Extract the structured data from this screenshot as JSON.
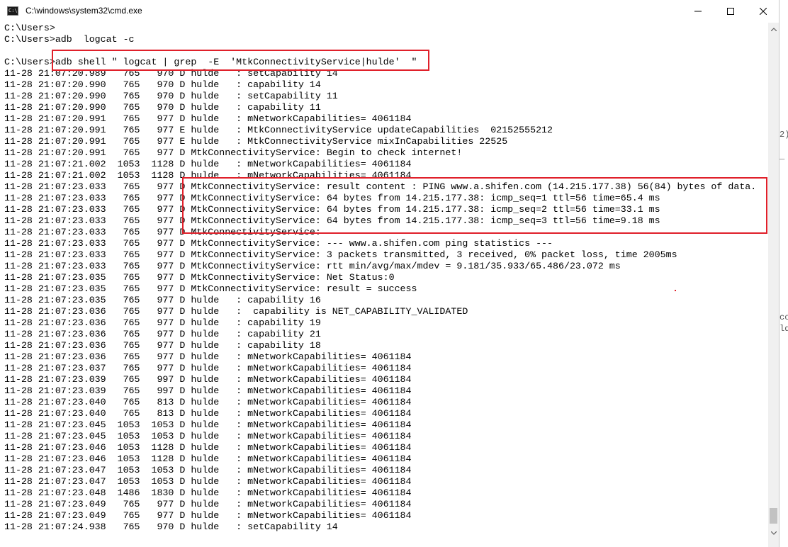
{
  "window": {
    "title": "C:\\windows\\system32\\cmd.exe",
    "icon": "cmd-app-icon",
    "controls": [
      "minimize-icon",
      "maximize-icon",
      "close-icon"
    ]
  },
  "terminal": {
    "lines": [
      "C:\\Users>",
      "C:\\Users>adb  logcat -c",
      "",
      "C:\\Users>adb shell \" logcat | grep  -E  'MtkConnectivityService|hulde'  \"",
      "11-28 21:07:20.989   765   970 D hulde   : setCapability 14",
      "11-28 21:07:20.990   765   970 D hulde   : capability 14",
      "11-28 21:07:20.990   765   970 D hulde   : setCapability 11",
      "11-28 21:07:20.990   765   970 D hulde   : capability 11",
      "11-28 21:07:20.991   765   977 D hulde   : mNetworkCapabilities= 4061184",
      "11-28 21:07:20.991   765   977 E hulde   : MtkConnectivityService updateCapabilities  02152555212",
      "11-28 21:07:20.991   765   977 E hulde   : MtkConnectivityService mixInCapabilities 22525",
      "11-28 21:07:20.991   765   977 D MtkConnectivityService: Begin to check internet!",
      "11-28 21:07:21.002  1053  1128 D hulde   : mNetworkCapabilities= 4061184",
      "11-28 21:07:21.002  1053  1128 D hulde   : mNetworkCapabilities= 4061184",
      "11-28 21:07:23.033   765   977 D MtkConnectivityService: result content : PING www.a.shifen.com (14.215.177.38) 56(84) bytes of data.",
      "11-28 21:07:23.033   765   977 D MtkConnectivityService: 64 bytes from 14.215.177.38: icmp_seq=1 ttl=56 time=65.4 ms",
      "11-28 21:07:23.033   765   977 D MtkConnectivityService: 64 bytes from 14.215.177.38: icmp_seq=2 ttl=56 time=33.1 ms",
      "11-28 21:07:23.033   765   977 D MtkConnectivityService: 64 bytes from 14.215.177.38: icmp_seq=3 ttl=56 time=9.18 ms",
      "11-28 21:07:23.033   765   977 D MtkConnectivityService:",
      "11-28 21:07:23.033   765   977 D MtkConnectivityService: --- www.a.shifen.com ping statistics ---",
      "11-28 21:07:23.033   765   977 D MtkConnectivityService: 3 packets transmitted, 3 received, 0% packet loss, time 2005ms",
      "11-28 21:07:23.033   765   977 D MtkConnectivityService: rtt min/avg/max/mdev = 9.181/35.933/65.486/23.072 ms",
      "11-28 21:07:23.035   765   977 D MtkConnectivityService: Net Status:0",
      "11-28 21:07:23.035   765   977 D MtkConnectivityService: result = success",
      "11-28 21:07:23.035   765   977 D hulde   : capability 16",
      "11-28 21:07:23.036   765   977 D hulde   :  capability is NET_CAPABILITY_VALIDATED",
      "11-28 21:07:23.036   765   977 D hulde   : capability 19",
      "11-28 21:07:23.036   765   977 D hulde   : capability 21",
      "11-28 21:07:23.036   765   977 D hulde   : capability 18",
      "11-28 21:07:23.036   765   977 D hulde   : mNetworkCapabilities= 4061184",
      "11-28 21:07:23.037   765   977 D hulde   : mNetworkCapabilities= 4061184",
      "11-28 21:07:23.039   765   997 D hulde   : mNetworkCapabilities= 4061184",
      "11-28 21:07:23.039   765   997 D hulde   : mNetworkCapabilities= 4061184",
      "11-28 21:07:23.040   765   813 D hulde   : mNetworkCapabilities= 4061184",
      "11-28 21:07:23.040   765   813 D hulde   : mNetworkCapabilities= 4061184",
      "11-28 21:07:23.045  1053  1053 D hulde   : mNetworkCapabilities= 4061184",
      "11-28 21:07:23.045  1053  1053 D hulde   : mNetworkCapabilities= 4061184",
      "11-28 21:07:23.046  1053  1128 D hulde   : mNetworkCapabilities= 4061184",
      "11-28 21:07:23.046  1053  1128 D hulde   : mNetworkCapabilities= 4061184",
      "11-28 21:07:23.047  1053  1053 D hulde   : mNetworkCapabilities= 4061184",
      "11-28 21:07:23.047  1053  1053 D hulde   : mNetworkCapabilities= 4061184",
      "11-28 21:07:23.048  1486  1830 D hulde   : mNetworkCapabilities= 4061184",
      "11-28 21:07:23.049   765   977 D hulde   : mNetworkCapabilities= 4061184",
      "11-28 21:07:23.049   765   977 D hulde   : mNetworkCapabilities= 4061184",
      "11-28 21:07:24.938   765   970 D hulde   : setCapability 14"
    ]
  },
  "background_fragments": [
    "2)",
    "_",
    "co",
    "ld"
  ],
  "colors": {
    "annotation_red": "#e0202a",
    "terminal_bg": "#ffffff",
    "terminal_fg": "#000000"
  }
}
